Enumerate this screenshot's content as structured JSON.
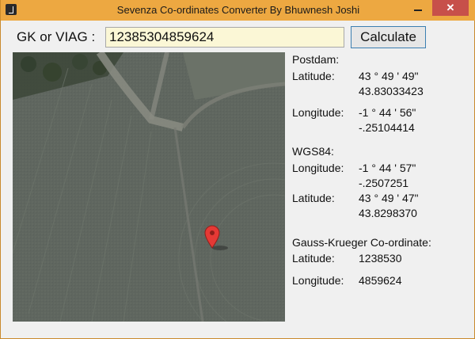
{
  "window": {
    "title": "Sevenza Co-ordinates Converter By Bhuwnesh Joshi",
    "close_glyph": "✕"
  },
  "input_row": {
    "label": "GK or VIAG :",
    "value": "12385304859624",
    "calculate_label": "Calculate"
  },
  "map": {
    "marker_icon": "map-pin-icon",
    "marker_color": "#e53935"
  },
  "postdam": {
    "heading": "Postdam:",
    "latitude_label": "Latitude:",
    "latitude_dms": "43 ° 49 ' 49\"",
    "latitude_decimal": "43.83033423",
    "longitude_label": "Longitude:",
    "longitude_dms": "-1 ° 44 ' 56\"",
    "longitude_decimal": "-.25104414"
  },
  "wgs84": {
    "heading": "WGS84:",
    "longitude_label": "Longitude:",
    "longitude_dms": "-1 ° 44 ' 57\"",
    "longitude_decimal": "-.2507251",
    "latitude_label": "Latitude:",
    "latitude_dms": "43 ° 49 ' 47\"",
    "latitude_decimal": "43.8298370"
  },
  "gauss_krueger": {
    "heading": "Gauss-Krueger Co-ordinate:",
    "latitude_label": "Latitude:",
    "latitude_value": "1238530",
    "longitude_label": "Longitude:",
    "longitude_value": "4859624"
  },
  "colors": {
    "titlebar": "#eda841",
    "close_button": "#c7504a",
    "input_background": "#fbf7d6",
    "button_border": "#3c7fb1"
  }
}
